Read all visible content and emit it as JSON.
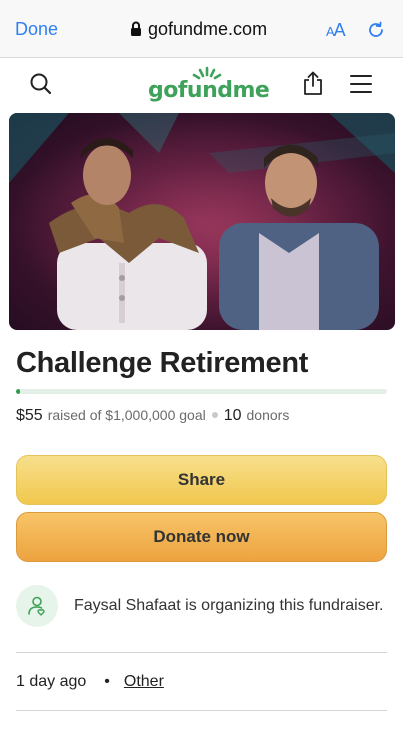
{
  "browser": {
    "done_label": "Done",
    "url": "gofundme.com",
    "text_size_label_small": "A",
    "text_size_label_large": "A",
    "lock_icon": "lock-icon",
    "reload_icon": "reload-icon"
  },
  "header": {
    "logo_text": "gofundme",
    "icons": [
      "search-icon",
      "share-icon",
      "menu-icon"
    ]
  },
  "campaign": {
    "title": "Challenge Retirement",
    "raised_amount": "$55",
    "raised_text": "raised of $1,000,000 goal",
    "donor_count": "10",
    "donor_label": "donors",
    "progress_percent": 0.0055
  },
  "buttons": {
    "share_label": "Share",
    "donate_label": "Donate now"
  },
  "organizer": {
    "text": "Faysal Shafaat is organizing this fundraiser."
  },
  "meta": {
    "time_ago": "1 day ago",
    "bullet": "•",
    "category": "Other"
  },
  "colors": {
    "brand_green": "#3ea25a",
    "link_blue": "#2f7ff0",
    "share_yellow": "#f1c84e",
    "donate_orange": "#eda33f"
  }
}
